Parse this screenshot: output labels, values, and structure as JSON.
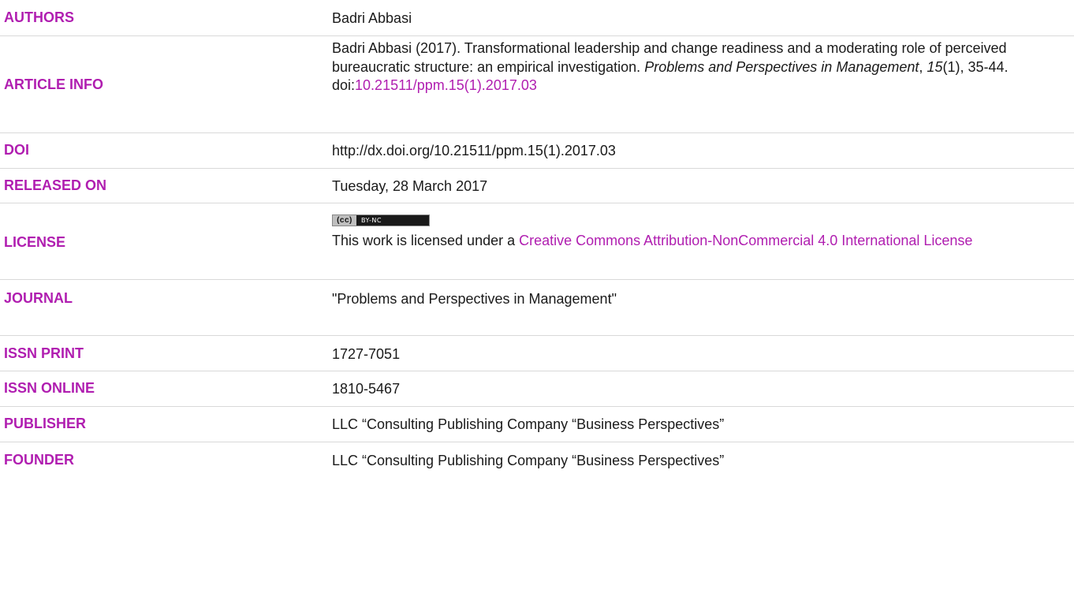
{
  "rows": {
    "authors": {
      "label": "AUTHORS",
      "value": "Badri Abbasi"
    },
    "article_info": {
      "label": "ARTICLE INFO",
      "citation_prefix": "Badri Abbasi (2017). Transformational leadership and change readiness and a moderating role of perceived bureaucratic structure: an empirical investigation.",
      "journal_italic": "Problems and Perspectives in Management",
      "comma": ",",
      "volume_italic": "15",
      "issue_pages": "(1), 35-44.",
      "doi_prefix": "doi:",
      "doi_link": "10.21511/ppm.15(1).2017.03"
    },
    "doi": {
      "label": "DOI",
      "value": "http://dx.doi.org/10.21511/ppm.15(1).2017.03"
    },
    "released_on": {
      "label": "RELEASED ON",
      "value": "Tuesday, 28 March 2017"
    },
    "license": {
      "label": "LICENSE",
      "badge_left": "(cc)",
      "badge_right": "BY-NC",
      "text_prefix": "This work is licensed under a",
      "link_text": "Creative Commons Attribution-NonCommercial 4.0 International License"
    },
    "journal": {
      "label": "JOURNAL",
      "value": "\"Problems and Perspectives in Management\""
    },
    "issn_print": {
      "label": "ISSN PRINT",
      "value": "1727-7051"
    },
    "issn_online": {
      "label": "ISSN ONLINE",
      "value": "1810-5467"
    },
    "publisher": {
      "label": "PUBLISHER",
      "value": "LLC “Consulting Publishing Company “Business Perspectives”"
    },
    "founder": {
      "label": "FOUNDER",
      "value": "LLC “Consulting Publishing Company “Business Perspectives”"
    }
  },
  "colors": {
    "label": "#b01eb0",
    "text": "#1a1a1a",
    "divider": "#d9d9d9"
  }
}
